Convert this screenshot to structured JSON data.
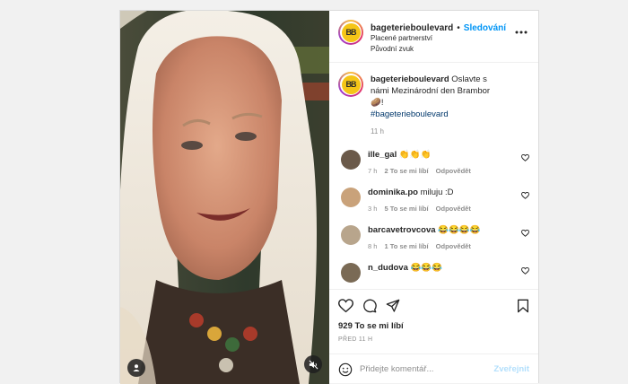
{
  "post": {
    "author": "bageterieboulevard",
    "separator": "•",
    "follow_label": "Sledování",
    "partnership": "Placené partnerství",
    "audio": "Původní zvuk",
    "logo_text": "BB",
    "caption": {
      "text": "Oslavte s námi Mezinárodní den Brambor",
      "emoji": "🥔",
      "suffix": "!",
      "hashtag": "#bageterieboulevard",
      "time": "11 h"
    }
  },
  "comments": [
    {
      "user": "ille_gal",
      "text": "",
      "emojis": [
        "👏",
        "👏",
        "👏"
      ],
      "time": "7 h",
      "likes": "2 To se mi líbí",
      "reply": "Odpovědět",
      "avatar_color": "#6b5a4a"
    },
    {
      "user": "dominika.po",
      "text": "miluju :D",
      "emojis": [],
      "time": "3 h",
      "likes": "5 To se mi líbí",
      "reply": "Odpovědět",
      "avatar_color": "#c9a27a"
    },
    {
      "user": "barcavetrovcova",
      "text": "",
      "emojis": [
        "😂",
        "😂",
        "😂",
        "😂"
      ],
      "time": "8 h",
      "likes": "1 To se mi líbí",
      "reply": "Odpovědět",
      "avatar_color": "#b8a58c"
    },
    {
      "user": "n_dudova",
      "text": "",
      "emojis": [
        "😂",
        "😂",
        "😂"
      ],
      "time": "",
      "likes": "",
      "reply": "",
      "avatar_color": "#7a6a55"
    }
  ],
  "actions": {
    "likes": "929 To se mi líbí",
    "date": "PŘED 11 H"
  },
  "add_comment": {
    "placeholder": "Přidejte komentář...",
    "publish": "Zveřejnit"
  },
  "colors": {
    "accent": "#0095f6",
    "clap_emoji": "#f5c542",
    "laugh_emoji": "#f2b632",
    "logo": "#f5c517"
  }
}
